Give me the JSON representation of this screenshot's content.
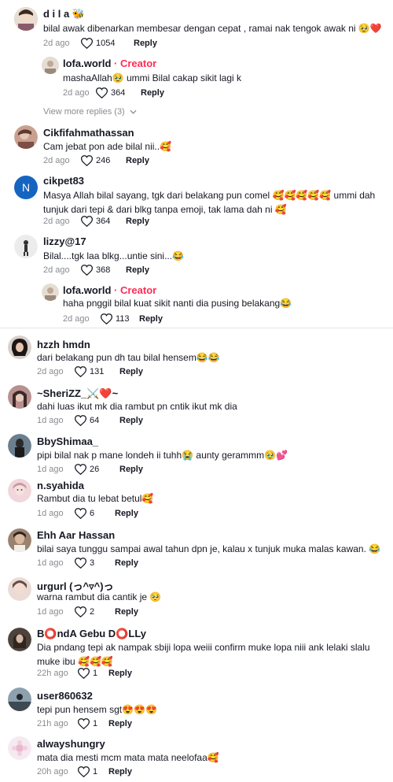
{
  "colors": {
    "creator": "#fe2c55",
    "meta": "#8a8b91",
    "text": "#161823"
  },
  "reply_label": "Reply",
  "comments": [
    {
      "user": "d i l a 🐝",
      "text": "bilal awak dibenarkan membesar dengan cepat , ramai nak tengok awak ni 🥹❤️",
      "date": "2d ago",
      "likes": "1054",
      "avatar_color": "#c9b7a8"
    },
    {
      "user": "lofa.world",
      "creator": "Creator",
      "text": "mashaAllah🥹 ummi Bilal cakap sikit lagi k",
      "date": "2d ago",
      "likes": "364",
      "avatar_color": "#d8d3c8"
    },
    {
      "user": "Cikfifahmathassan",
      "text": "Cam jebat pon ade bilal nii..🥰",
      "date": "2d ago",
      "likes": "246",
      "avatar_color": "#b58d7a"
    },
    {
      "user": "cikpet83",
      "text": "Masya Allah bilal sayang, tgk dari belakang pun comel 🥰🥰🥰🥰🥰 ummi dah tunjuk dari tepi & dari blkg tanpa emoji, tak lama dah ni 🥰",
      "date": "2d ago",
      "likes": "364",
      "avatar_color": "#1565c0",
      "avatar_letter": "N"
    },
    {
      "user": "lizzy@17",
      "text": "Bilal....tgk laa blkg...untie sini...😂",
      "date": "2d ago",
      "likes": "368",
      "avatar_color": "#e8e8e8"
    },
    {
      "user": "lofa.world",
      "creator": "Creator",
      "text": "haha pnggil bilal kuat sikit nanti dia pusing belakang😂",
      "date": "2d ago",
      "likes": "113",
      "avatar_color": "#d8d3c8"
    },
    {
      "user": "hzzh hmdn",
      "text": "dari belakang pun dh tau bilal hensem😂😂",
      "date": "2d ago",
      "likes": "131",
      "avatar_color": "#3a2f2c"
    },
    {
      "user": "~SheriZZ_⚔️❤️~",
      "text": "dahi luas ikut mk dia rambut pn cntik ikut mk dia",
      "date": "1d ago",
      "likes": "64",
      "avatar_color": "#a88080"
    },
    {
      "user": "BbyShimaa_",
      "text": "pipi bilal nak p mane londeh ii tuhh😭 aunty gerammm🥹💕",
      "date": "1d ago",
      "likes": "26",
      "avatar_color": "#5a6a78"
    },
    {
      "user": "n.syahida",
      "text": "Rambut dia tu lebat betul🥰",
      "date": "1d ago",
      "likes": "6",
      "avatar_color": "#e6c0c5"
    },
    {
      "user": "Ehh Aar Hassan",
      "text": "bilai saya tunggu sampai awal tahun dpn je, kalau x tunjuk muka malas kawan. 😂",
      "date": "1d ago",
      "likes": "3",
      "avatar_color": "#8a7060"
    },
    {
      "user": "urgurl (っ^▿^)っ",
      "text": "warna rambut dia cantik je 🥺",
      "date": "1d ago",
      "likes": "2",
      "avatar_color": "#d9b8b0"
    },
    {
      "user": "B⭕ndA Gebu D⭕LLy",
      "text": "Dia pndang tepi ak nampak sbiji lopa weiii confirm muke lopa niii ank lelaki slalu muke ibu 🥰🥰🥰",
      "date": "22h ago",
      "likes": "1",
      "avatar_color": "#4a3f3a"
    },
    {
      "user": "user860632",
      "text": "tepi pun hensem sgt😍😍😍",
      "date": "21h ago",
      "likes": "1",
      "avatar_color": "#6b7d8c"
    },
    {
      "user": "alwayshungry",
      "text": "mata dia mesti mcm mata mata neelofaa🥰",
      "date": "20h ago",
      "likes": "1",
      "avatar_color": "#e8d4e0"
    }
  ],
  "view_more": "View more replies (3)"
}
